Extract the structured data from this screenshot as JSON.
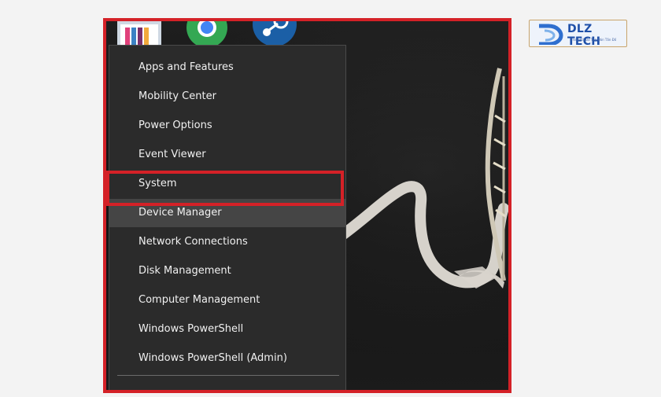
{
  "brand": {
    "logo_text": "DLZ TECH",
    "tagline": "Think Đà Đâ Tạp Đán Tấn Đố",
    "accent_color": "#d42127",
    "logo_color": "#1e4fa8"
  },
  "desktop": {
    "shortcuts": [
      {
        "icon": "app-icon"
      },
      {
        "icon": "chrome-icon"
      },
      {
        "icon": "steam-icon"
      }
    ]
  },
  "menu": {
    "items": [
      {
        "label": "Apps and Features"
      },
      {
        "label": "Mobility Center"
      },
      {
        "label": "Power Options"
      },
      {
        "label": "Event Viewer"
      },
      {
        "label": "System"
      },
      {
        "label": "Device Manager",
        "highlighted": true
      },
      {
        "label": "Network Connections"
      },
      {
        "label": "Disk Management"
      },
      {
        "label": "Computer Management"
      },
      {
        "label": "Windows PowerShell"
      },
      {
        "label": "Windows PowerShell (Admin)"
      }
    ]
  }
}
